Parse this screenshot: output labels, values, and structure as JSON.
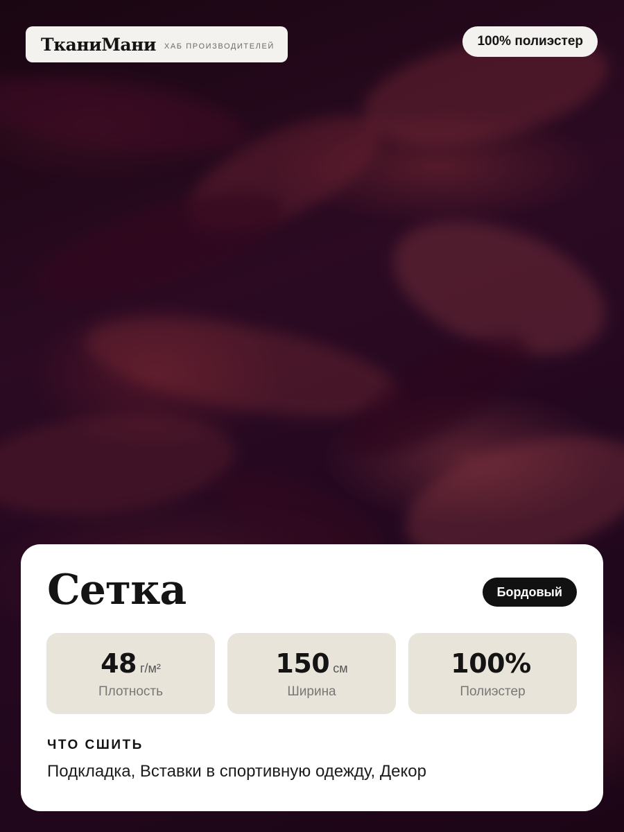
{
  "brand": {
    "name": "ТканиМани",
    "tagline": "ХАБ ПРОИЗВОДИТЕЛЕЙ"
  },
  "material_badge": "100% полиэстер",
  "product": {
    "title": "Сетка",
    "color": "Бордовый"
  },
  "stats": [
    {
      "value": "48",
      "unit": "г/м²",
      "label": "Плотность"
    },
    {
      "value": "150",
      "unit": "см",
      "label": "Ширина"
    },
    {
      "value": "100%",
      "unit": "",
      "label": "Полиэстер"
    }
  ],
  "usage": {
    "heading": "ЧТО СШИТЬ",
    "text": "Подкладка, Вставки в спортивную одежду, Декор"
  },
  "colors": {
    "fabric": "#2b0a22",
    "card": "#ffffff",
    "stat_tile": "#e9e4d9",
    "badge_dark": "#111111"
  }
}
